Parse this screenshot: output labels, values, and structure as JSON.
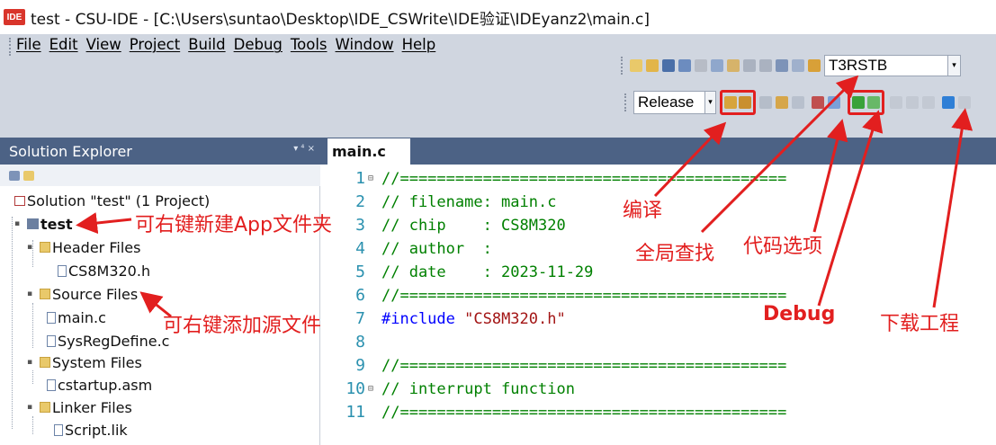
{
  "window": {
    "icon_text": "IDE",
    "title": "test - CSU-IDE - [C:\\Users\\suntao\\Desktop\\IDE_CSWrite\\IDE验证\\IDEyanz2\\main.c]"
  },
  "menu": [
    "File",
    "Edit",
    "View",
    "Project",
    "Build",
    "Debug",
    "Tools",
    "Window",
    "Help"
  ],
  "toolbar": {
    "target_select": "T3RSTB",
    "config_select": "Release"
  },
  "solution_explorer": {
    "title": "Solution Explorer",
    "header_buttons": "▾ ⁴ ×",
    "tree": [
      {
        "label": "Solution \"test\" (1 Project)"
      },
      {
        "label": "test"
      },
      {
        "label": "Header Files"
      },
      {
        "label": "CS8M320.h"
      },
      {
        "label": "Source Files"
      },
      {
        "label": "main.c"
      },
      {
        "label": "SysRegDefine.c"
      },
      {
        "label": "System Files"
      },
      {
        "label": "cstartup.asm"
      },
      {
        "label": "Linker Files"
      },
      {
        "label": "Script.lik"
      }
    ]
  },
  "editor": {
    "tab": "main.c",
    "lines": [
      {
        "n": "1",
        "text": "//=========================================="
      },
      {
        "n": "2",
        "text": "// filename: main.c"
      },
      {
        "n": "3",
        "text": "// chip    : CS8M320"
      },
      {
        "n": "4",
        "text": "// author  :"
      },
      {
        "n": "5",
        "text": "// date    : 2023-11-29"
      },
      {
        "n": "6",
        "text": "//=========================================="
      },
      {
        "n": "7",
        "pre": "#include ",
        "str": "\"CS8M320.h\""
      },
      {
        "n": "8",
        "text": ""
      },
      {
        "n": "9",
        "text": "//=========================================="
      },
      {
        "n": "10",
        "text": "// interrupt function"
      },
      {
        "n": "11",
        "text": "//=========================================="
      }
    ]
  },
  "annotations": {
    "new_app_folder": "可右键新建App文件夹",
    "add_source": "可右键添加源文件",
    "compile": "编译",
    "global_find": "全局查找",
    "code_options": "代码选项",
    "debug": "Debug",
    "download": "下载工程"
  },
  "colors": {
    "accent_red": "#e21f1f",
    "panel_header": "#4c6285",
    "toolbar_bg": "#d0d6e0",
    "comment_green": "#008000"
  }
}
